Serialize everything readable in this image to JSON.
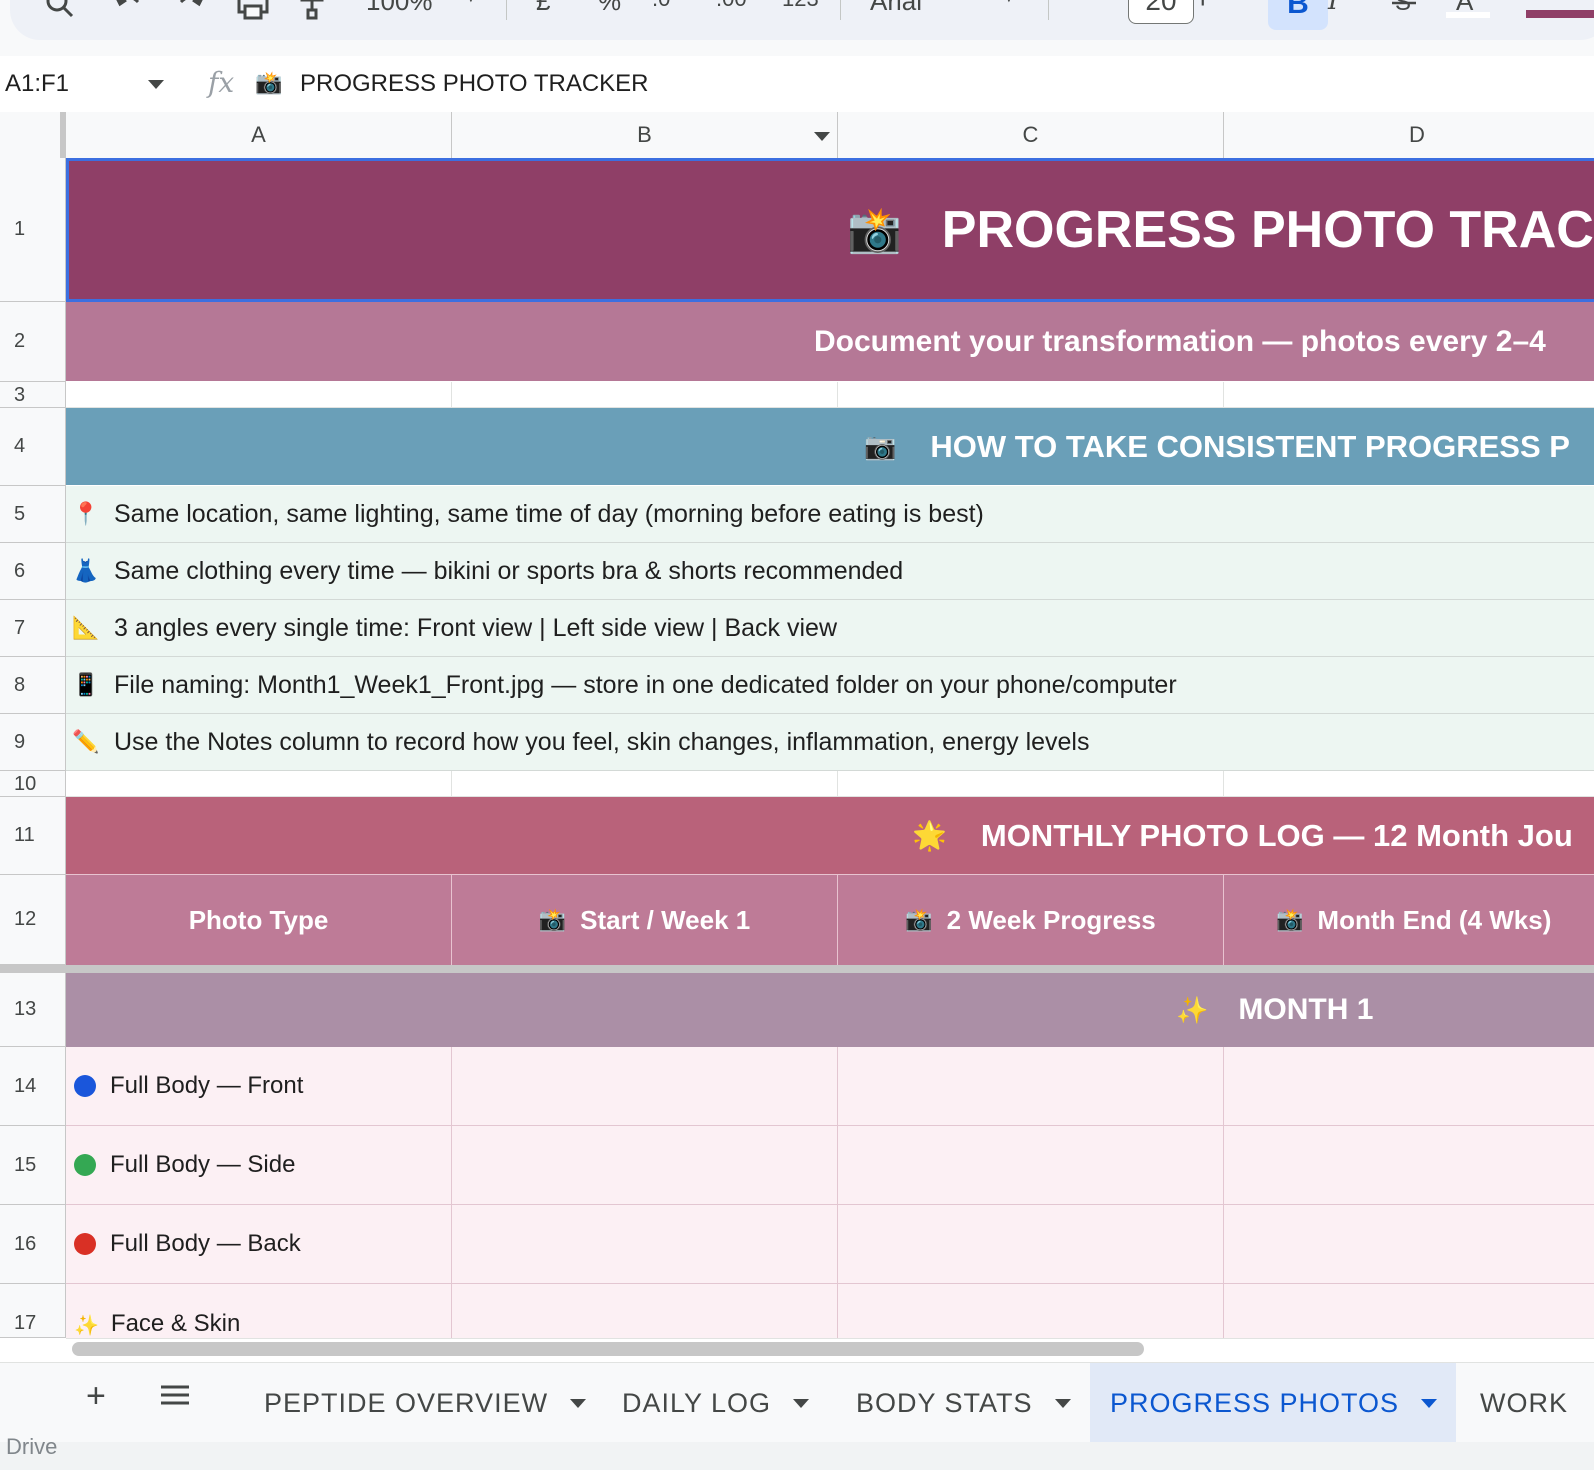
{
  "toolbar": {
    "zoom": "100%",
    "currency": "£",
    "percent": "%",
    "decrease_decimals": ".0",
    "increase_decimals": ".00",
    "number_format": "123",
    "font_name": "Arial",
    "font_size": "20",
    "bold_label": "B",
    "italic_label": "I",
    "text_color_label": "A"
  },
  "formula_bar": {
    "name_box": "A1:F1",
    "fx_label": "fx",
    "content_icon": "📸",
    "content": "PROGRESS PHOTO TRACKER"
  },
  "columns": [
    "A",
    "B",
    "C",
    "D"
  ],
  "rows": {
    "numbers": [
      "1",
      "2",
      "3",
      "4",
      "5",
      "6",
      "7",
      "8",
      "9",
      "10",
      "11",
      "12",
      "13",
      "14",
      "15",
      "16",
      "17"
    ],
    "title_icon": "📸",
    "title": "PROGRESS PHOTO TRAC",
    "subtitle": "Document your transformation — photos every 2–4",
    "howto_icon": "📷",
    "howto_heading": "HOW TO TAKE CONSISTENT PROGRESS P",
    "tips": [
      {
        "icon": "📍",
        "text": "Same location, same lighting, same time of day (morning before eating is best)"
      },
      {
        "icon": "👗",
        "text": "Same clothing every time — bikini or sports bra & shorts recommended"
      },
      {
        "icon": "📐",
        "text": "3 angles every single time: Front view | Left side view | Back view"
      },
      {
        "icon": "📱",
        "text": "File naming: Month1_Week1_Front.jpg — store in one dedicated folder on your phone/computer"
      },
      {
        "icon": "✏️",
        "text": "Use the Notes column to record how you feel, skin changes, inflammation, energy levels"
      }
    ],
    "log_icon": "🌟",
    "log_heading": "MONTHLY PHOTO LOG — 12 Month Jou",
    "headers": [
      {
        "icon": "",
        "text": "Photo Type"
      },
      {
        "icon": "📸",
        "text": "Start / Week 1"
      },
      {
        "icon": "📸",
        "text": "2 Week Progress"
      },
      {
        "icon": "📸",
        "text": "Month End (4 Wks)"
      }
    ],
    "month_icon": "✨",
    "month_label": "MONTH 1",
    "items": [
      {
        "marker": "blue-dot",
        "color": "#1a56db",
        "text": "Full Body — Front"
      },
      {
        "marker": "green-dot",
        "color": "#34a853",
        "text": "Full Body — Side"
      },
      {
        "marker": "red-dot",
        "color": "#d93025",
        "text": "Full Body — Back"
      },
      {
        "marker": "sparkle",
        "color": "#f4c430",
        "icon": "✨",
        "text": "Face & Skin"
      }
    ]
  },
  "sheet_tabs": [
    {
      "label": "PEPTIDE OVERVIEW",
      "active": false
    },
    {
      "label": "DAILY LOG",
      "active": false
    },
    {
      "label": "BODY STATS",
      "active": false
    },
    {
      "label": "PROGRESS PHOTOS",
      "active": true
    },
    {
      "label": "WORK",
      "active": false
    }
  ],
  "footer_peek": "Drive",
  "colors": {
    "title_bg": "#8f3f67",
    "subtitle_bg": "#b57896",
    "howto_bg": "#6a9fb8",
    "tips_bg": "#edf6f2",
    "log_bg": "#b9627a",
    "header_bg": "#be7b97",
    "month_bg": "#ab8fa6",
    "item_bg": "#fcf0f4",
    "selection": "#3c6fe0",
    "active_tab": "#0b57d0"
  }
}
